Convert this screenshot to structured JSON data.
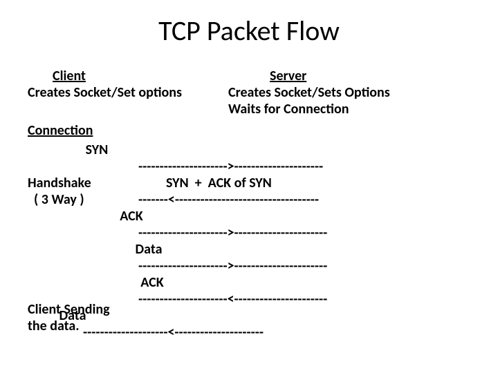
{
  "title": "TCP Packet Flow",
  "client": {
    "header": "Client",
    "line1": "Creates Socket/Set options"
  },
  "server": {
    "header": "Server",
    "line1": "Creates Socket/Sets Options",
    "line2": "Waits for Connection"
  },
  "connection_label": "Connection",
  "handshake": {
    "line1": "Handshake",
    "line2": "  ( 3 Way )"
  },
  "sending": {
    "line1": "Client Sending",
    "line2": "the data."
  },
  "flow": {
    "syn": "SYN",
    "syn_arrow": "--------------------->---------------------",
    "synack": "SYN  +  ACK of SYN",
    "synack_arrow": "-------<----------------------------------",
    "ack": "ACK",
    "ack_arrow": "--------------------->----------------------",
    "data1": "Data",
    "data1_arrow": "--------------------->----------------------",
    "ack2": "ACK",
    "ack2_arrow": "---------------------<----------------------",
    "data2": "Data",
    "data2_arrow": "--------------------<---------------------"
  }
}
